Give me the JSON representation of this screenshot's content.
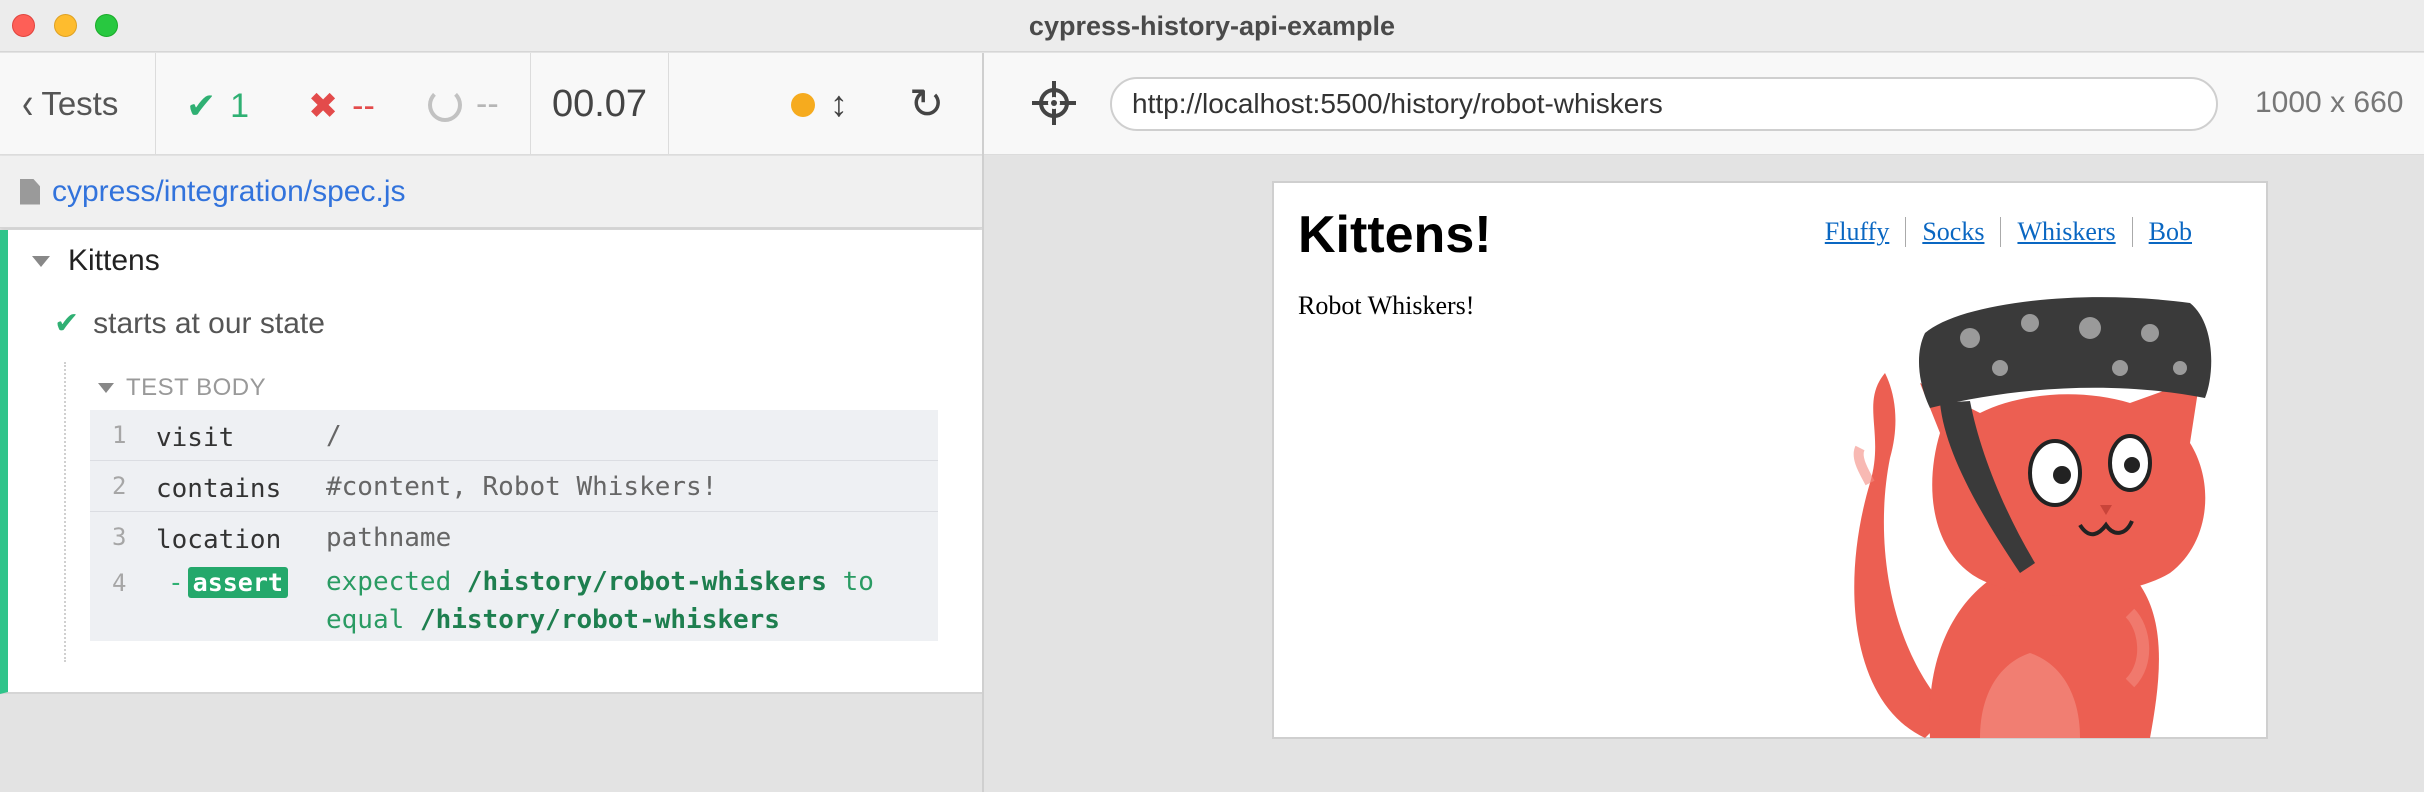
{
  "window": {
    "title": "cypress-history-api-example"
  },
  "reporter": {
    "tests_label": "Tests",
    "passed": "1",
    "failed": "--",
    "pending": "--",
    "duration": "00.07",
    "spec_path": "cypress/integration/spec.js",
    "colors": {
      "pass": "#2fb073",
      "fail": "#e34b4b",
      "running": "#f6ab1e",
      "link": "#3273dc"
    }
  },
  "suite": {
    "title": "Kittens",
    "test": {
      "title": "starts at our state",
      "body_label": "TEST BODY",
      "commands": [
        {
          "num": "1",
          "name": "visit",
          "message": "/"
        },
        {
          "num": "2",
          "name": "contains",
          "message": "#content, Robot Whiskers!"
        },
        {
          "num": "3",
          "name": "location",
          "message": "pathname"
        },
        {
          "num": "4",
          "prefix": "-",
          "name": "assert",
          "message": {
            "w1": "expected",
            "v1": "/history/robot-whiskers",
            "w2": "to",
            "w3": "equal",
            "v2": "/history/robot-whiskers"
          }
        }
      ]
    }
  },
  "aut": {
    "url": "http://localhost:5500/history/robot-whiskers",
    "viewport": "1000 x 660",
    "page": {
      "heading": "Kittens!",
      "nav": [
        "Fluffy",
        "Socks",
        "Whiskers",
        "Bob"
      ],
      "content": "Robot Whiskers!"
    }
  },
  "icons": {
    "back": "chevron-left-icon",
    "pass": "check-icon",
    "fail": "x-icon",
    "pending": "spinner-icon",
    "resize": "up-down-arrow-icon",
    "reload": "reload-icon",
    "selector": "crosshair-icon",
    "file": "file-icon"
  }
}
